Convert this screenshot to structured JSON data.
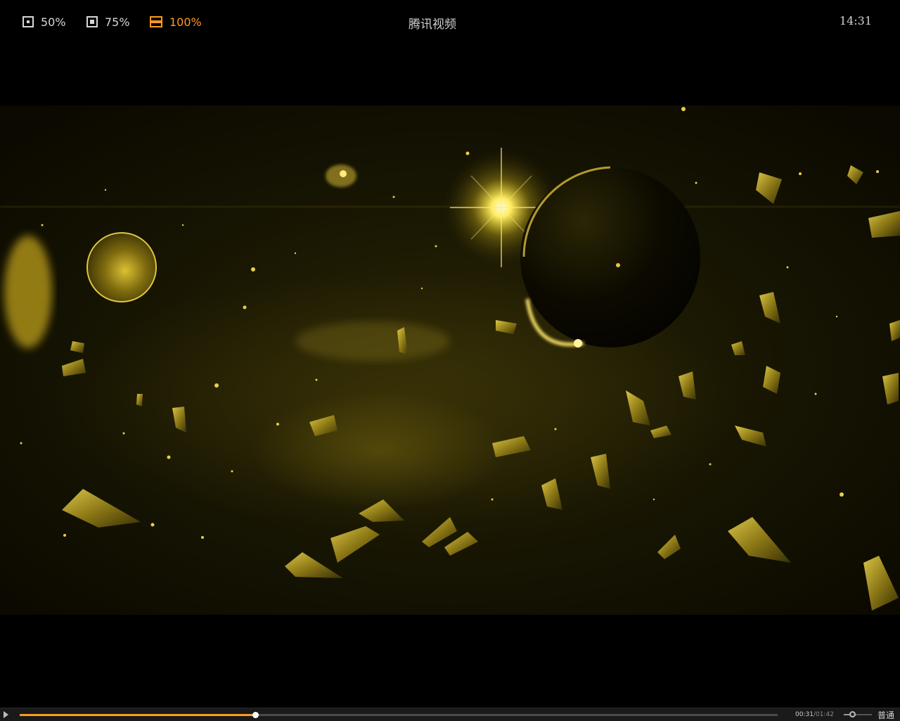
{
  "topbar": {
    "zoom_options": [
      {
        "label": "50%",
        "active": false,
        "icon": "window-small-icon"
      },
      {
        "label": "75%",
        "active": false,
        "icon": "window-medium-icon"
      },
      {
        "label": "100%",
        "active": true,
        "icon": "window-full-icon"
      }
    ],
    "title": "腾讯视频",
    "clock": "14:31"
  },
  "player": {
    "video_description_icon": "space-scene-video-frame",
    "progress_fraction": 0.311,
    "time_current": "00:31",
    "time_separator": "/",
    "time_duration": "01:42",
    "volume_fraction": 0.3,
    "quality_label": "普通"
  },
  "colors": {
    "accent": "#ff9a1e",
    "background": "#000000",
    "text": "#d0d0d0"
  }
}
